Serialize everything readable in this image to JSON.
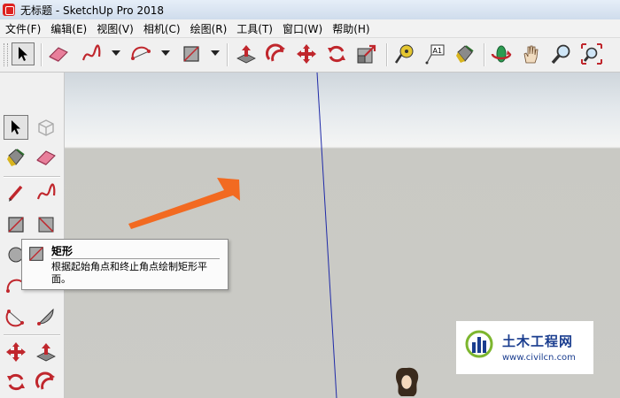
{
  "window": {
    "title": "无标题 - SketchUp Pro 2018"
  },
  "menu": [
    "文件(F)",
    "编辑(E)",
    "视图(V)",
    "相机(C)",
    "绘图(R)",
    "工具(T)",
    "窗口(W)",
    "帮助(H)"
  ],
  "toolbar_icons": [
    "select-icon",
    "eraser-icon",
    "freehand-icon",
    "arc-icon",
    "rectangle-icon",
    "push-pull-icon",
    "follow-me-icon",
    "move-icon",
    "rotate-icon",
    "scale-icon",
    "tape-measure-icon",
    "text-icon",
    "paint-bucket-icon",
    "orbit-icon",
    "pan-icon",
    "zoom-icon",
    "zoom-extents-icon"
  ],
  "tooltip": {
    "title": "矩形",
    "description": "根据起始角点和终止角点绘制矩形平面。"
  },
  "watermark": {
    "name": "土木工程网",
    "url": "www.civilcn.com"
  },
  "colors": {
    "annotation_arrow": "#f26a21",
    "icon_red": "#c0272d",
    "axis_blue": "#1f2aa8"
  }
}
